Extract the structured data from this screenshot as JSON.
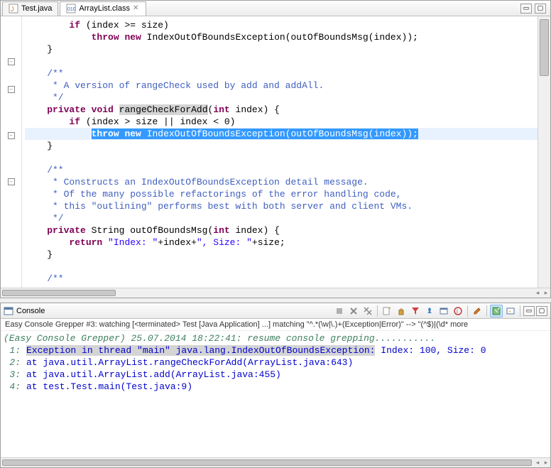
{
  "tabs": [
    {
      "label": "Test.java",
      "icon": "java-file-icon",
      "active": false
    },
    {
      "label": "ArrayList.class",
      "icon": "class-file-icon",
      "active": true
    }
  ],
  "code": {
    "l1_pre": "        ",
    "l1_kw": "if",
    "l1_post": " (index >= size)",
    "l2_pre": "            ",
    "l2_kw1": "throw",
    "l2_kw2": "new",
    "l2_post": " IndexOutOfBoundsException(outOfBoundsMsg(index));",
    "l3": "    }",
    "c1": "    /**",
    "c2": "     * A version of rangeCheck used by add and addAll.",
    "c3": "     */",
    "l4_pre": "    ",
    "l4_kw1": "private",
    "l4_kw2": "void",
    "l4_mid": " ",
    "l4_mark": "rangeCheckForAdd",
    "l4_post": "(",
    "l4_kw3": "int",
    "l4_tail": " index) {",
    "l5_pre": "        ",
    "l5_kw": "if",
    "l5_post": " (index > size || index < 0)",
    "l6_pre": "            ",
    "l6_kw1": "throw",
    "l6_mid": " ",
    "l6_kw2": "new",
    "l6_sel": " IndexOutOfBoundsException(outOfBoundsMsg(index));",
    "l7": "    }",
    "c4": "    /**",
    "c5": "     * Constructs an IndexOutOfBoundsException detail message.",
    "c6": "     * Of the many possible refactorings of the error handling code,",
    "c7": "     * this \"outlining\" performs best with both server and client VMs.",
    "c8": "     */",
    "l8_pre": "    ",
    "l8_kw1": "private",
    "l8_mid": " String outOfBoundsMsg(",
    "l8_kw2": "int",
    "l8_tail": " index) {",
    "l9_pre": "        ",
    "l9_kw": "return",
    "l9_mid": " ",
    "l9_s1": "\"Index: \"",
    "l9_mid2": "+index+",
    "l9_s2": "\", Size: \"",
    "l9_tail": "+size;",
    "l10": "    }",
    "c9": "    /**"
  },
  "console": {
    "title": "Console",
    "status": "Easy Console Grepper #3: watching [<terminated> Test [Java Application] ...] matching \"^.*(\\w|\\.)+(Exception|Error)\" --> \"(^$)|(\\d* more",
    "init": "(Easy Console Grepper) 25.07.2014 18:22:41: resume console grepping...........",
    "n1": "1:",
    "n2": "2:",
    "n3": "3:",
    "n4": "4:",
    "r1a": "Exception in thread \"main\" java.lang.IndexOutOfBoundsException:",
    "r1b": " Index: 100, Size: 0",
    "r2": "    at java.util.ArrayList.rangeCheckForAdd(ArrayList.java:643)",
    "r3": "    at java.util.ArrayList.add(ArrayList.java:455)",
    "r4": "    at test.Test.main(Test.java:9)"
  }
}
